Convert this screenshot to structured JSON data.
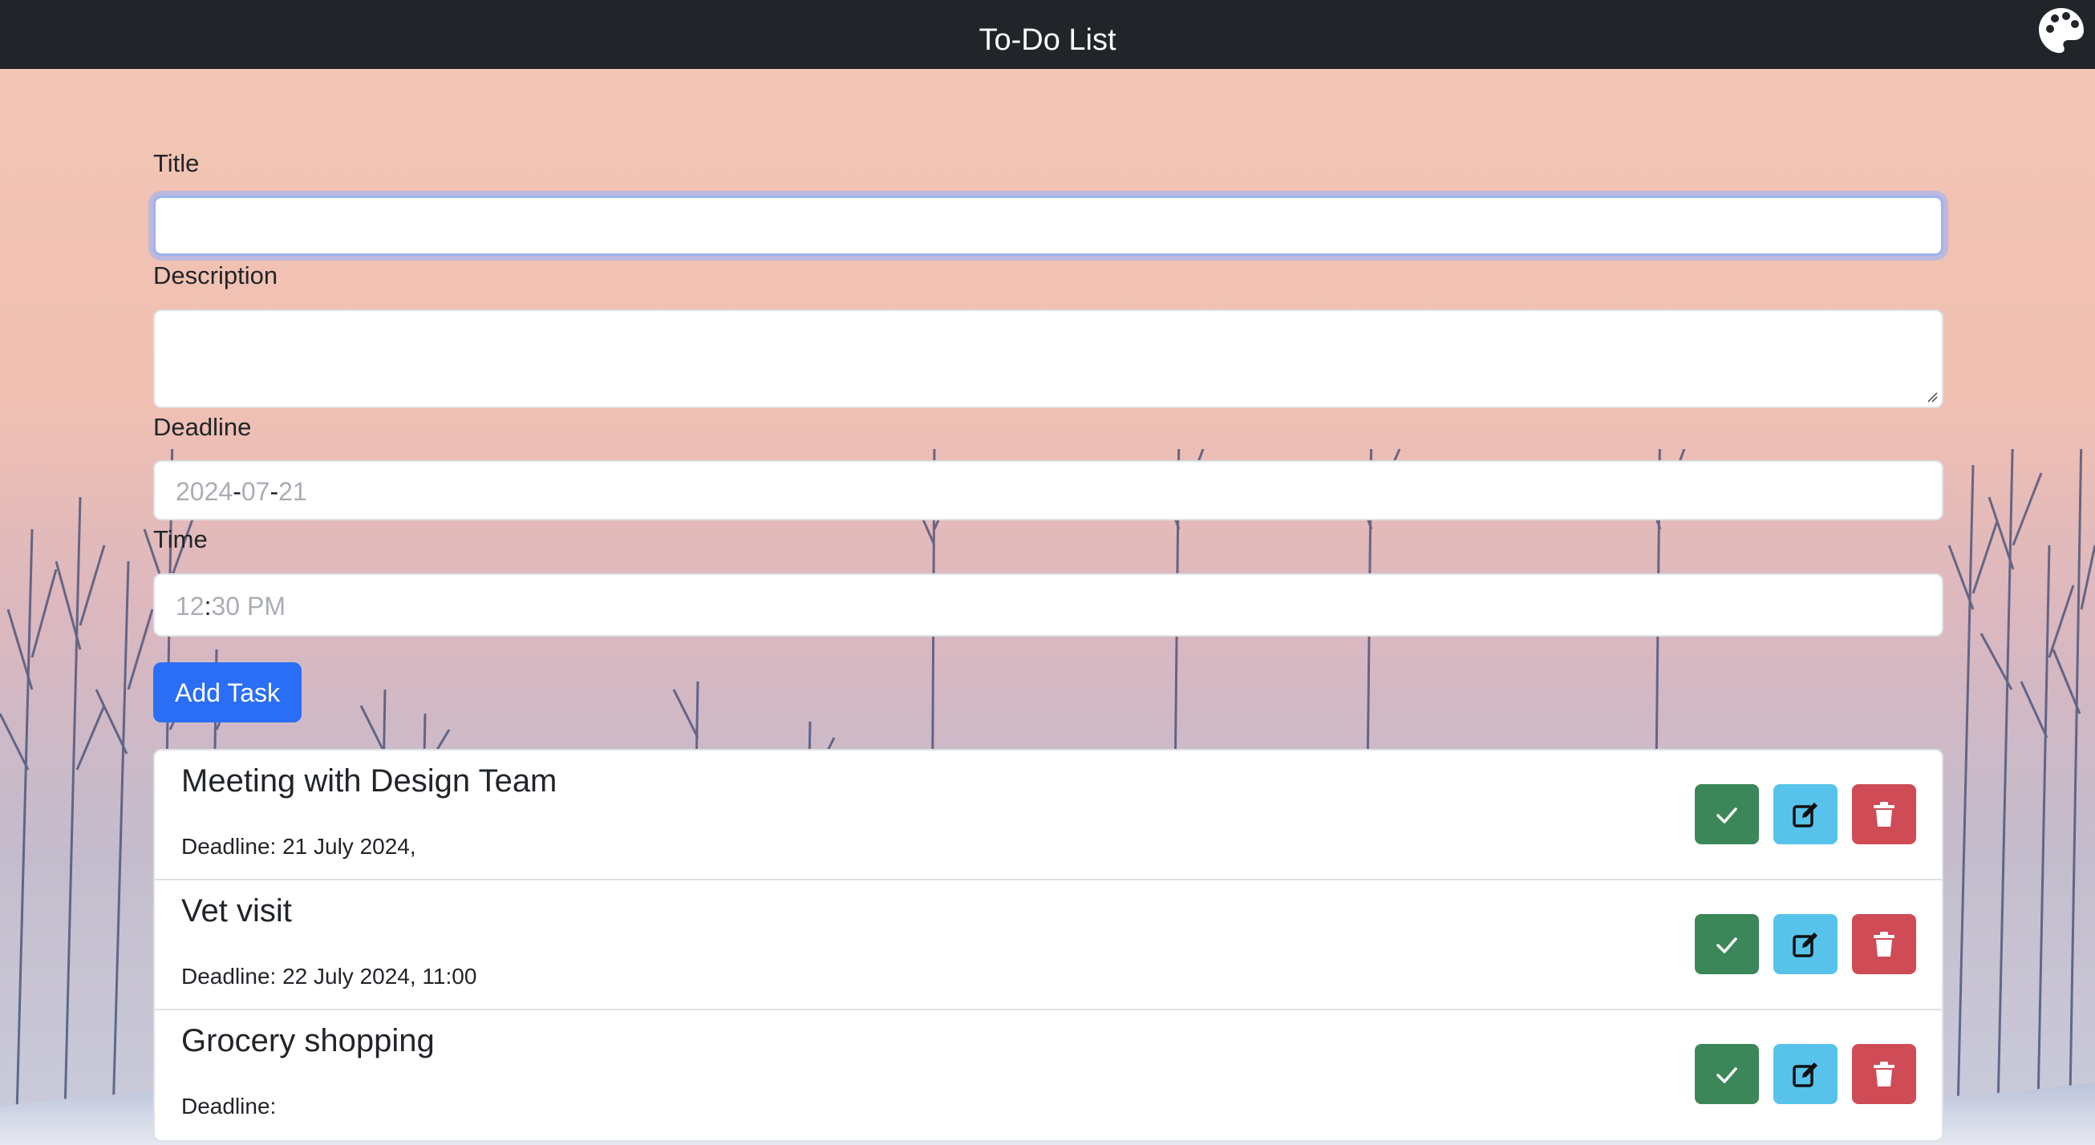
{
  "app": {
    "title": "To-Do List",
    "theme_icon": "palette-icon"
  },
  "form": {
    "title_label": "Title",
    "title_value": "",
    "description_label": "Description",
    "description_value": "",
    "deadline_label": "Deadline",
    "deadline_parts": [
      "2024",
      "07",
      "21"
    ],
    "deadline_sep": "-",
    "time_label": "Time",
    "time_hour": "12",
    "time_sep": ":",
    "time_rest": "30 PM",
    "add_button_label": "Add Task"
  },
  "tasks": [
    {
      "title": "Meeting with Design Team",
      "deadline": "Deadline: 21 July 2024,"
    },
    {
      "title": "Vet visit",
      "deadline": "Deadline: 22 July 2024, 11:00"
    },
    {
      "title": "Grocery shopping",
      "deadline": "Deadline:"
    }
  ],
  "colors": {
    "navbar": "#212529",
    "primary": "#2a6ef6",
    "success": "#3b8759",
    "info": "#57c3ea",
    "danger": "#cf4b56"
  },
  "icons": {
    "complete": "check-icon",
    "edit": "edit-icon",
    "delete": "trash-icon"
  }
}
